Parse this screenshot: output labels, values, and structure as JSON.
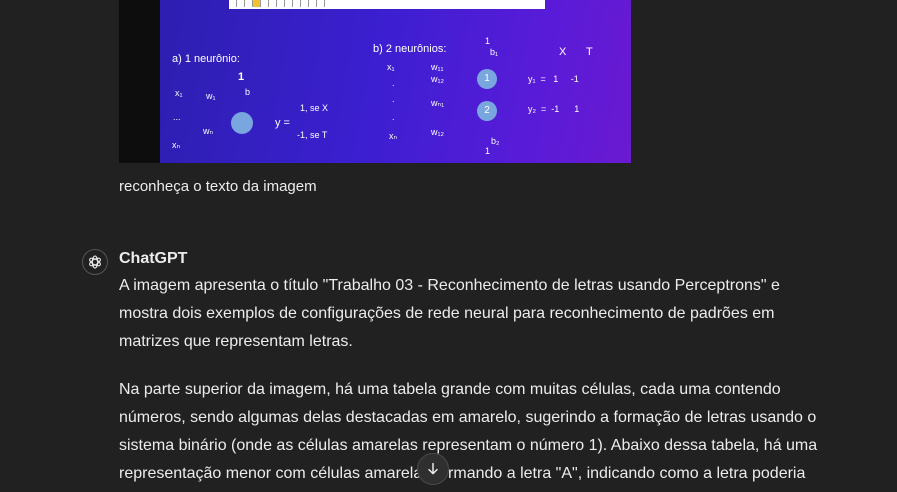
{
  "user_message": {
    "image": {
      "label_a": "a) 1 neurônio:",
      "label_b": "b) 2 neurônios:",
      "a_x1": "x₁",
      "a_w1": "w₁",
      "a_one": "1",
      "a_b": "b",
      "a_dots": "...",
      "a_wn": "wₙ",
      "a_xn": "xₙ",
      "a_y": "y =",
      "a_case1": "1, se X",
      "a_case2": "-1, se T",
      "b_x1": "x₁",
      "b_w11": "w₁₁",
      "b_w12": "w₁₂",
      "b_dot1": ".",
      "b_dot2": ".",
      "b_wn1": "wₙ₁",
      "b_dot3": ".",
      "b_xn": "xₙ",
      "b_wn2": "w₁₂",
      "b_top_one": "1",
      "b_b1": "b₁",
      "b_bottom_one": "1",
      "b_b2": "b₂",
      "neuron1": "1",
      "neuron2": "2",
      "head_x": "X",
      "head_t": "T",
      "row1": "y₁  =   1     -1",
      "row2": "y₂  =  -1      1"
    },
    "caption": "reconheça o texto da imagem"
  },
  "assistant": {
    "name": "ChatGPT",
    "icon": "openai-logo-icon",
    "paragraphs": [
      "A imagem apresenta o título \"Trabalho 03 - Reconhecimento de letras usando Perceptrons\" e mostra dois exemplos de configurações de rede neural para reconhecimento de padrões em matrizes que representam letras.",
      "Na parte superior da imagem, há uma tabela grande com muitas células, cada uma contendo números, sendo algumas delas destacadas em amarelo, sugerindo a formação de letras usando o sistema binário (onde as células amarelas representam o número 1). Abaixo dessa tabela, há uma representação menor com células amarelas formando a letra \"A\", indicando como a letra poderia"
    ]
  },
  "scroll_button": {
    "icon": "arrow-down-icon"
  },
  "colors": {
    "background": "#212121",
    "text": "#ececec",
    "neuron": "#7aa6e0",
    "highlight": "#f2c12e"
  }
}
